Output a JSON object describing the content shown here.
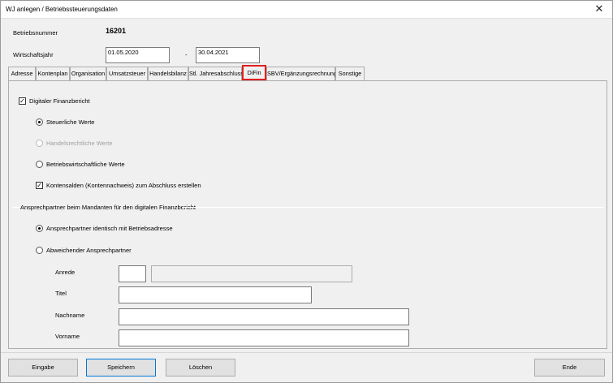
{
  "window": {
    "title": "WJ anlegen / Betriebssteuerungsdaten",
    "close_glyph": "✕"
  },
  "header": {
    "betriebsnummer_label": "Betriebsnummer",
    "betriebsnummer_value": "16201",
    "wirtschaftsjahr_label": "Wirtschaftsjahr",
    "date_from": "01.05.2020",
    "date_separator": "-",
    "date_to": "30.04.2021"
  },
  "tabs": [
    {
      "label": "Adresse"
    },
    {
      "label": "Kontenplan"
    },
    {
      "label": "Organisation"
    },
    {
      "label": "Umsatzsteuer"
    },
    {
      "label": "Handelsbilanz"
    },
    {
      "label": "Stl. Jahresabschluss"
    },
    {
      "label": "DiFin",
      "active": true
    },
    {
      "label": "SBV/Ergänzungsrechnung"
    },
    {
      "label": "Sonstige"
    }
  ],
  "difin": {
    "digital_report_label": "Digitaler Finanzbericht",
    "digital_report_checked": true,
    "check_glyph": "✓",
    "values_options": [
      {
        "label": "Steuerliche Werte",
        "selected": true,
        "disabled": false
      },
      {
        "label": "Handelsrechtliche Werte",
        "selected": false,
        "disabled": true
      },
      {
        "label": "Betriebswirtschaftliche Werte",
        "selected": false,
        "disabled": false
      }
    ],
    "kontensalden_label": "Kontensalden (Kontennachweis) zum Abschluss erstellen",
    "kontensalden_checked": true
  },
  "contact": {
    "group_title": "Ansprechpartner beim Mandanten für den digitalen Finanzbericht",
    "options": [
      {
        "label": "Ansprechpartner identisch mit Betriebsadresse",
        "selected": true
      },
      {
        "label": "Abweichender Ansprechpartner",
        "selected": false
      }
    ],
    "anrede_label": "Anrede",
    "anrede_value": "",
    "anrede_text_value": "",
    "titel_label": "Titel",
    "titel_value": "",
    "nachname_label": "Nachname",
    "nachname_value": "",
    "vorname_label": "Vorname",
    "vorname_value": ""
  },
  "buttons": {
    "eingabe": "Eingabe",
    "speichern": "Speichern",
    "loeschen": "Löschen",
    "ende": "Ende"
  }
}
